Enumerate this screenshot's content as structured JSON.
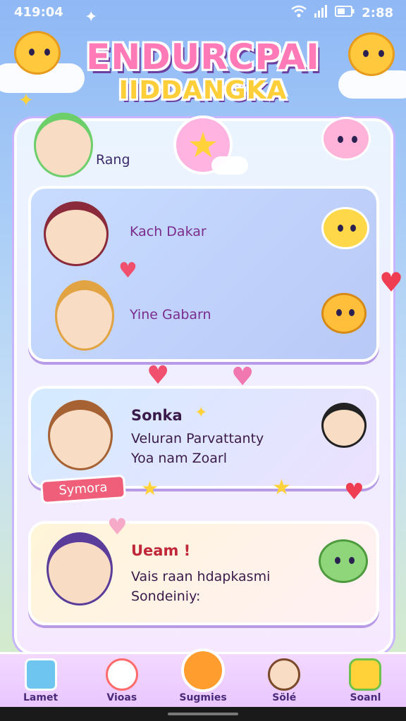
{
  "status_bar": {
    "time_left": "419:04",
    "time_right": "2:88"
  },
  "header": {
    "title_line1": "ENDURCPAI",
    "title_line2": "IIDDANGKA"
  },
  "top": {
    "label": "Rang"
  },
  "card1": {
    "row1": "Kach Dakar",
    "row2": "Yine Gabarn"
  },
  "card2": {
    "title": "Sonka",
    "line1": "Veluran Parvattanty",
    "line2": "Yoa nam Zoarl",
    "tag": "Symora"
  },
  "card3": {
    "title": "Ueam !",
    "line1": "Vais raan hdapkasmi",
    "line2": "Sondeiniy:"
  },
  "nav": [
    {
      "label": "Lamet",
      "icon": "house-icon"
    },
    {
      "label": "Vioas",
      "icon": "mascot-icon"
    },
    {
      "label": "Sugmies",
      "icon": "chat-bubble-icon"
    },
    {
      "label": "Sölé",
      "icon": "character-icon"
    },
    {
      "label": "Soanl",
      "icon": "fruit-icon"
    }
  ],
  "colors": {
    "accent": "#ff7ab6",
    "title_yellow": "#ffcf3a",
    "text": "#7a2c8f",
    "nav_bg": "#f3d8ff"
  }
}
